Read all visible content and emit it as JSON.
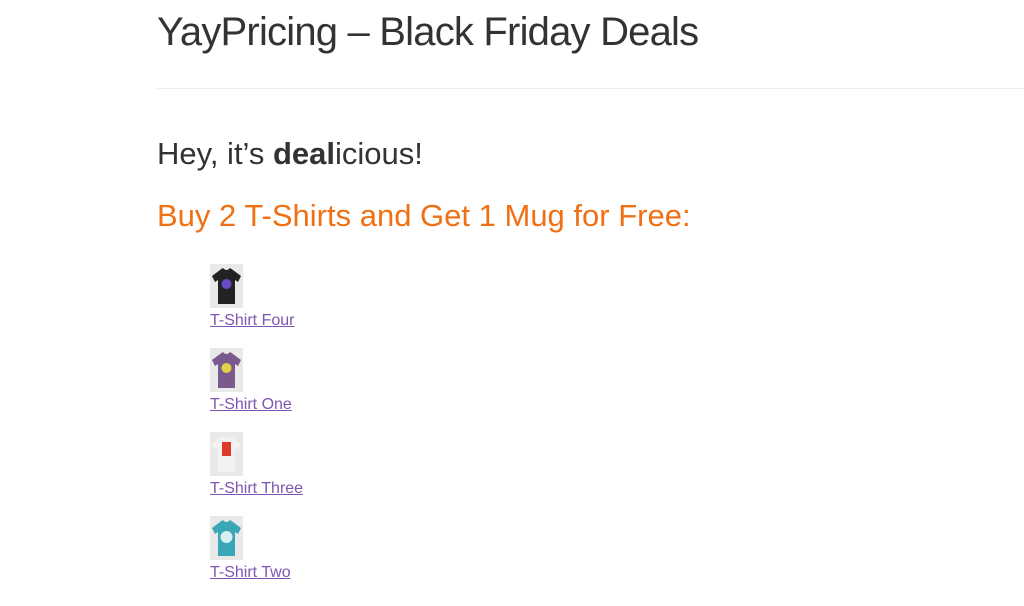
{
  "page": {
    "title": "YayPricing – Black Friday Deals"
  },
  "content": {
    "intro_prefix": "Hey, it’s ",
    "intro_bold": "deal",
    "intro_suffix": "icious!",
    "offer_heading": "Buy 2 T-Shirts and Get 1 Mug for Free:",
    "offer_color": "#f07014",
    "link_color": "#7f54b3"
  },
  "products": [
    {
      "name": "T-Shirt Four",
      "shirt_color": "#222222",
      "print_color": "#6a4bc4",
      "icon": "tshirt-icon"
    },
    {
      "name": "T-Shirt One",
      "shirt_color": "#7a5a8c",
      "print_color": "#e2d44a",
      "icon": "tshirt-icon"
    },
    {
      "name": "T-Shirt Three",
      "shirt_color": "#f2f2f2",
      "print_color": "#e03a2a",
      "icon": "tshirt-icon"
    },
    {
      "name": "T-Shirt Two",
      "shirt_color": "#3aa7b8",
      "print_color": "#d8eef2",
      "icon": "tshirt-icon"
    }
  ]
}
